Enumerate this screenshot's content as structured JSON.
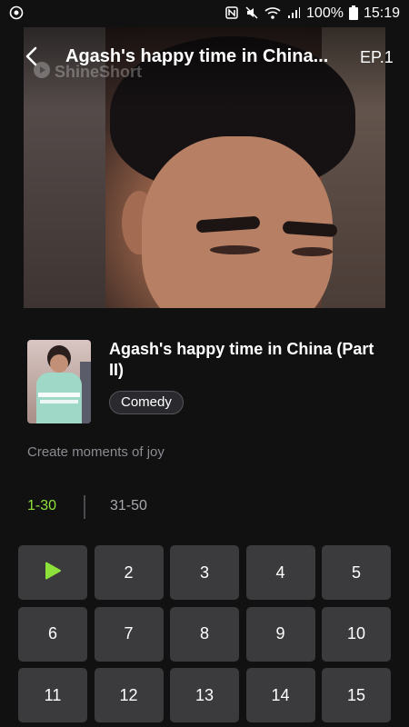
{
  "status_bar": {
    "battery": "100%",
    "time": "15:19",
    "icons": [
      "app-notification-icon",
      "nfc-icon",
      "mute-icon",
      "wifi-icon",
      "signal-icon",
      "battery-icon"
    ]
  },
  "player": {
    "title": "Agash's happy time in China...",
    "episode_label": "EP.1",
    "watermark": "ShineShort"
  },
  "show": {
    "title": "Agash's happy time in China (Part II)",
    "genre": "Comedy",
    "tagline": "Create moments of joy"
  },
  "range_tabs": [
    {
      "label": "1-30",
      "active": true
    },
    {
      "label": "31-50",
      "active": false
    }
  ],
  "episodes": [
    "1",
    "2",
    "3",
    "4",
    "5",
    "6",
    "7",
    "8",
    "9",
    "10",
    "11",
    "12",
    "13",
    "14",
    "15"
  ],
  "current_episode": "1",
  "colors": {
    "accent": "#8ee03b",
    "background": "#111111",
    "tile": "#3b3b3d"
  }
}
